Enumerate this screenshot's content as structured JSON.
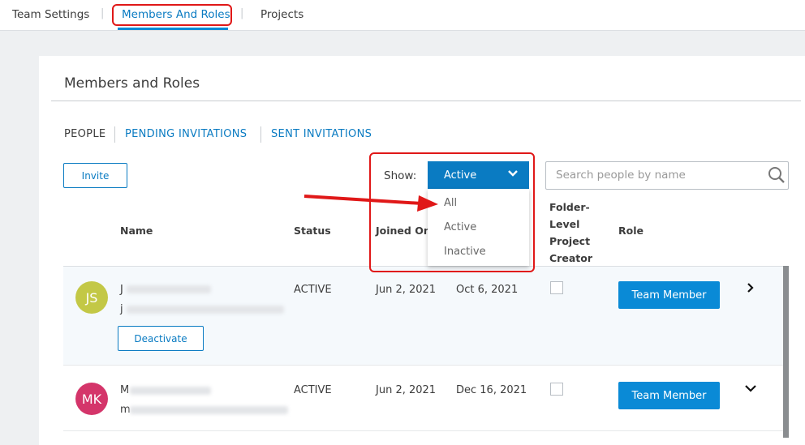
{
  "top_nav": {
    "tabs": [
      {
        "label": "Team Settings"
      },
      {
        "label": "Members And Roles"
      },
      {
        "label": "Projects"
      }
    ],
    "active": "Members And Roles"
  },
  "page": {
    "title": "Members and Roles"
  },
  "sub_tabs": [
    {
      "label": "PEOPLE"
    },
    {
      "label": "PENDING INVITATIONS"
    },
    {
      "label": "SENT INVITATIONS"
    }
  ],
  "toolbar": {
    "invite_label": "Invite",
    "show_label": "Show:",
    "filter_value": "Active",
    "filter_options": [
      "All",
      "Active",
      "Inactive"
    ],
    "search_placeholder": "Search people by name"
  },
  "table": {
    "headers": {
      "name": "Name",
      "status": "Status",
      "joined": "Joined On",
      "folder": [
        "Folder-",
        "Level",
        "Project",
        "Creator"
      ],
      "role": "Role"
    },
    "rows": [
      {
        "initials": "JS",
        "avatar_color": "#c3c846",
        "name_initial": "J",
        "email_initial": "j",
        "status": "ACTIVE",
        "joined": "Jun 2, 2021",
        "last": "Oct 6, 2021",
        "role": "Team Member",
        "action": "Deactivate"
      },
      {
        "initials": "MK",
        "avatar_color": "#d4356a",
        "name_initial": "M",
        "email_initial": "m",
        "status": "ACTIVE",
        "joined": "Jun 2, 2021",
        "last": "Dec 16, 2021",
        "role": "Team Member"
      }
    ]
  },
  "colors": {
    "accent": "#0a7bc2",
    "highlight": "#e01818"
  }
}
